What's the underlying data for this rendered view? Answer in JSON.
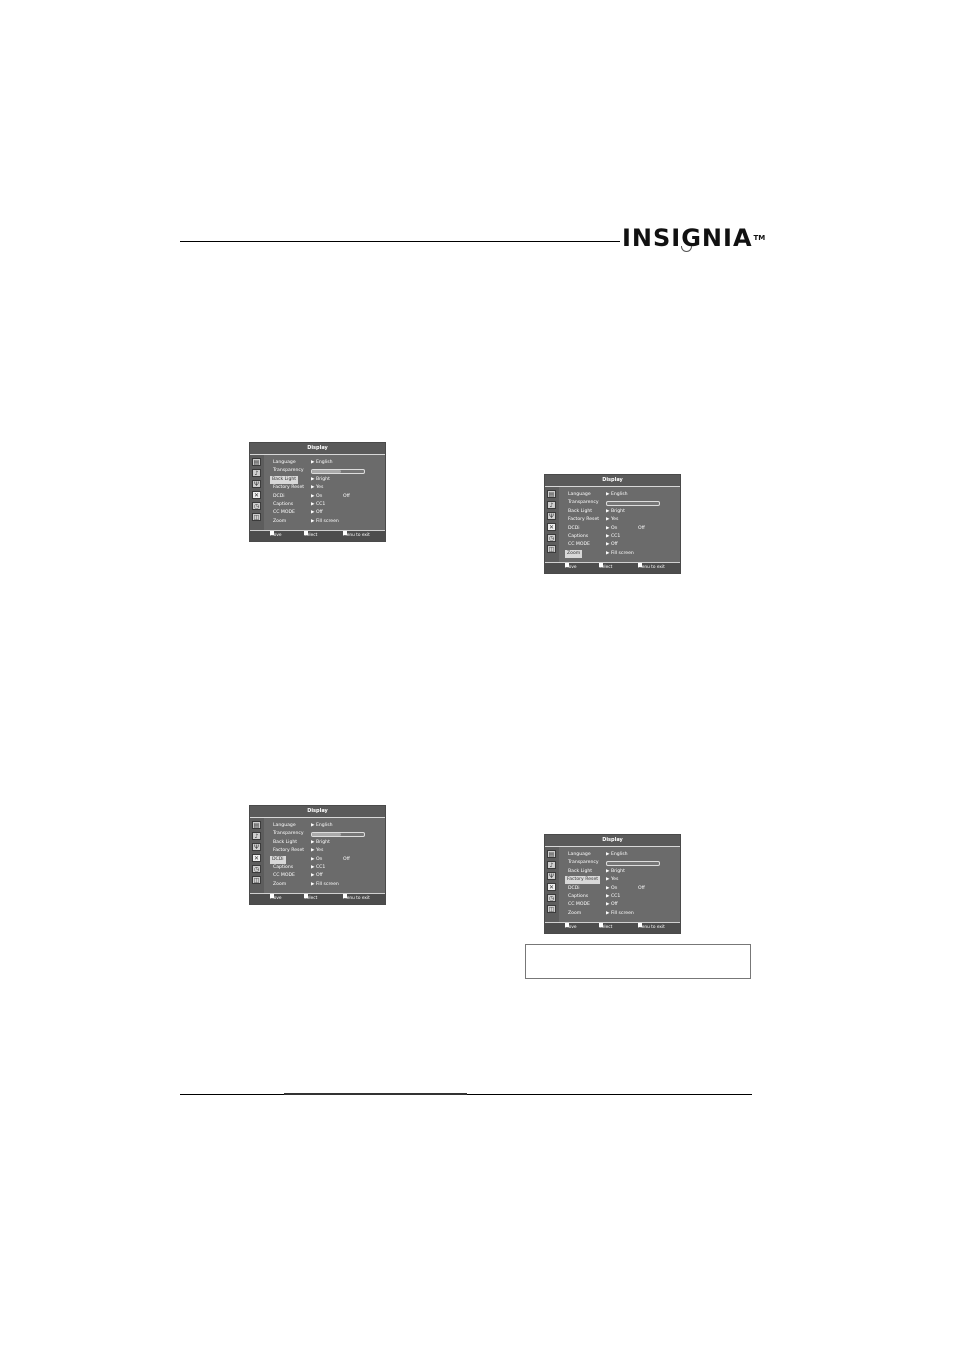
{
  "header": {
    "brand": "INSIGNIA",
    "trademark": "TM"
  },
  "menus": [
    {
      "title": "Display",
      "highlight": 2,
      "rows": [
        {
          "label": "Language",
          "value": "English",
          "type": "value"
        },
        {
          "label": "Transparency",
          "type": "bar",
          "level": 0.55
        },
        {
          "label": "Back Light",
          "value": "Bright",
          "type": "value"
        },
        {
          "label": "Factory Reset",
          "value": "Yes",
          "type": "value"
        },
        {
          "label": "DCDi",
          "value": "On",
          "extra": "Off",
          "type": "value"
        },
        {
          "label": "Captions",
          "value": "CC1",
          "type": "value"
        },
        {
          "label": "CC MODE",
          "value": "Off",
          "type": "value"
        },
        {
          "label": "Zoom",
          "value": "Fill screen",
          "type": "value"
        }
      ],
      "footer": {
        "move": "Move",
        "select": "Select",
        "exit": "Menu to exit"
      }
    },
    {
      "title": "Display",
      "highlight": 7,
      "rows": [
        {
          "label": "Language",
          "value": "English",
          "type": "value"
        },
        {
          "label": "Transparency",
          "type": "bar",
          "level": 0.0
        },
        {
          "label": "Back Light",
          "value": "Bright",
          "type": "value"
        },
        {
          "label": "Factory Reset",
          "value": "Yes",
          "type": "value"
        },
        {
          "label": "DCDi",
          "value": "On",
          "extra": "Off",
          "type": "value"
        },
        {
          "label": "Captions",
          "value": "CC1",
          "type": "value"
        },
        {
          "label": "CC MODE",
          "value": "Off",
          "type": "value"
        },
        {
          "label": "Zoom",
          "value": "Fill screen",
          "type": "value"
        }
      ],
      "footer": {
        "move": "Move",
        "select": "Select",
        "exit": "Menu to exit"
      }
    },
    {
      "title": "Display",
      "highlight": 4,
      "rows": [
        {
          "label": "Language",
          "value": "English",
          "type": "value"
        },
        {
          "label": "Transparency",
          "type": "bar",
          "level": 0.55
        },
        {
          "label": "Back Light",
          "value": "Bright",
          "type": "value"
        },
        {
          "label": "Factory Reset",
          "value": "Yes",
          "type": "value"
        },
        {
          "label": "DCDi",
          "value": "On",
          "extra": "Off",
          "type": "value"
        },
        {
          "label": "Captions",
          "value": "CC1",
          "type": "value"
        },
        {
          "label": "CC MODE",
          "value": "Off",
          "type": "value"
        },
        {
          "label": "Zoom",
          "value": "Fill screen",
          "type": "value"
        }
      ],
      "footer": {
        "move": "Move",
        "select": "Select",
        "exit": "Menu to exit"
      }
    },
    {
      "title": "Display",
      "highlight": 3,
      "rows": [
        {
          "label": "Language",
          "value": "English",
          "type": "value"
        },
        {
          "label": "Transparency",
          "type": "bar",
          "level": 0.0
        },
        {
          "label": "Back Light",
          "value": "Bright",
          "type": "value"
        },
        {
          "label": "Factory Reset",
          "value": "Yes",
          "type": "value"
        },
        {
          "label": "DCDi",
          "value": "On",
          "extra": "Off",
          "type": "value"
        },
        {
          "label": "Captions",
          "value": "CC1",
          "type": "value"
        },
        {
          "label": "CC MODE",
          "value": "Off",
          "type": "value"
        },
        {
          "label": "Zoom",
          "value": "Fill screen",
          "type": "value"
        }
      ],
      "footer": {
        "move": "Move",
        "select": "Select",
        "exit": "Menu to exit"
      }
    }
  ],
  "sidebar_icons": [
    "picture-icon",
    "sound-icon",
    "channel-icon",
    "setup-icon",
    "timer-icon",
    "input-icon"
  ],
  "sidebar_selected": 3,
  "colors": {
    "osd_bg": "#6b6b6b",
    "highlight": "#d8d8d8",
    "text": "#ffffff"
  }
}
